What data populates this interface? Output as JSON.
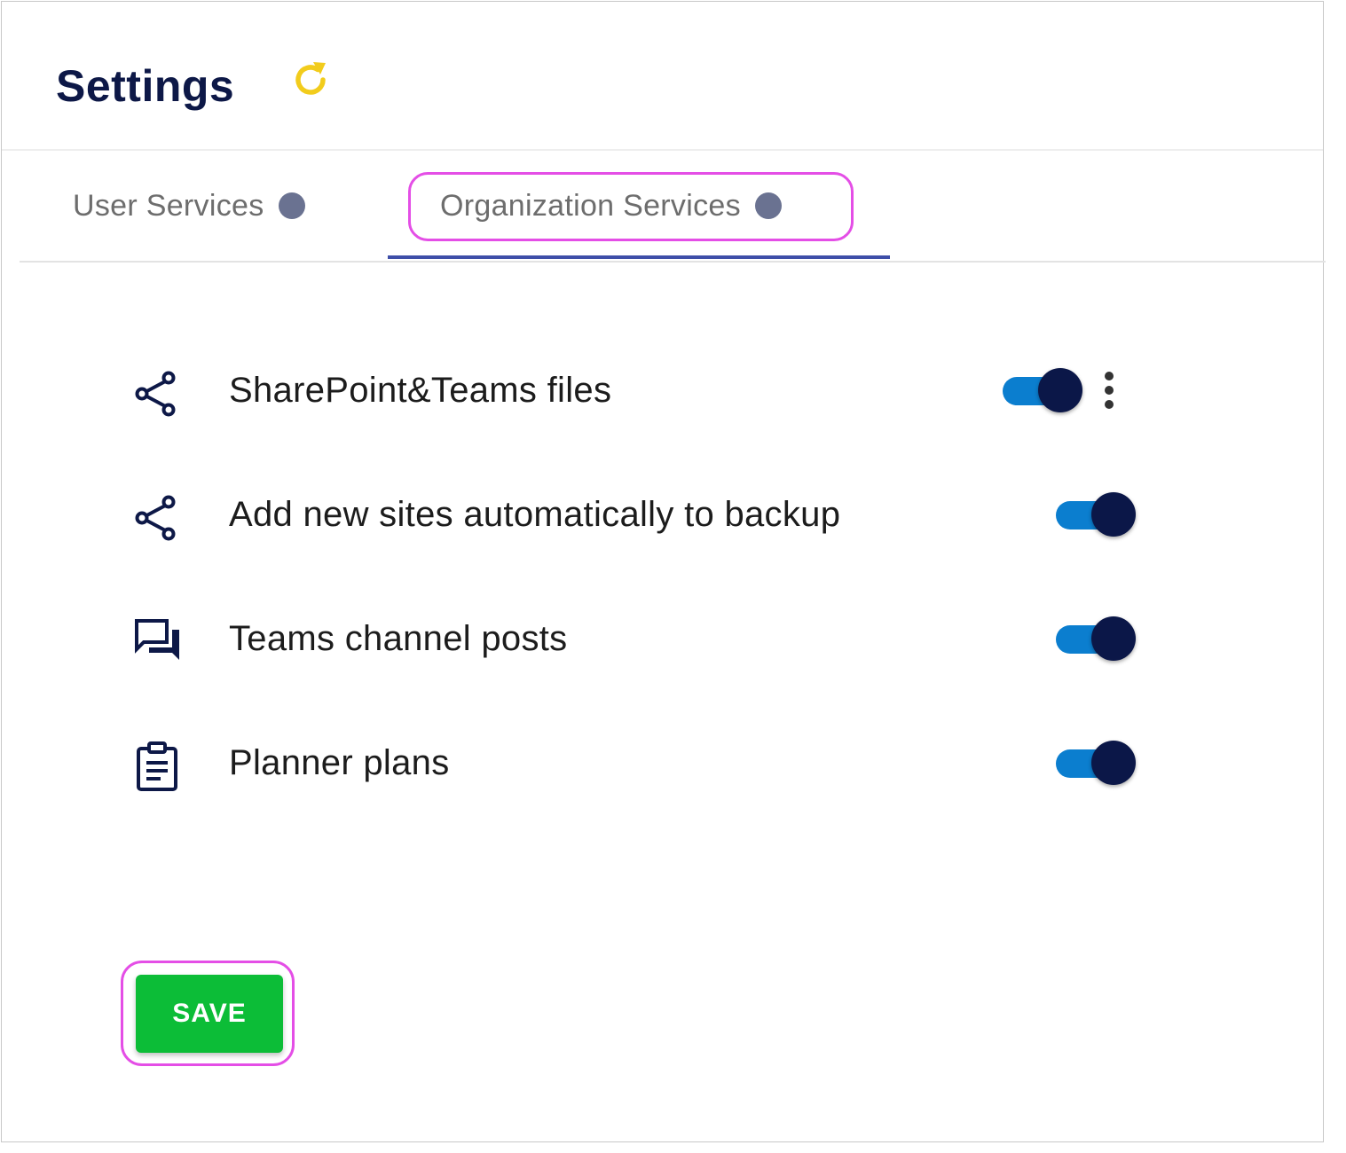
{
  "header": {
    "title": "Settings",
    "refresh_icon": "refresh-icon",
    "refresh_color": "#f2cc1c"
  },
  "tabs": [
    {
      "label": "User Services",
      "active": false
    },
    {
      "label": "Organization Services",
      "active": true
    }
  ],
  "services": [
    {
      "icon": "share-icon",
      "label": "SharePoint&Teams files",
      "enabled": true,
      "has_menu": true
    },
    {
      "icon": "share-icon",
      "label": "Add new sites automatically to backup",
      "enabled": true,
      "has_menu": false
    },
    {
      "icon": "chat-icon",
      "label": "Teams channel posts",
      "enabled": true,
      "has_menu": false
    },
    {
      "icon": "clipboard-icon",
      "label": "Planner plans",
      "enabled": true,
      "has_menu": false
    }
  ],
  "actions": {
    "save_label": "SAVE"
  },
  "colors": {
    "title": "#0d1847",
    "tab_text": "#6d6d6d",
    "tab_dot": "#6a7291",
    "tab_underline": "#3e4ea8",
    "toggle_track": "#0b7ecf",
    "toggle_knob": "#0b1748",
    "save_button": "#0cbd37",
    "highlight": "#e44ee6"
  }
}
